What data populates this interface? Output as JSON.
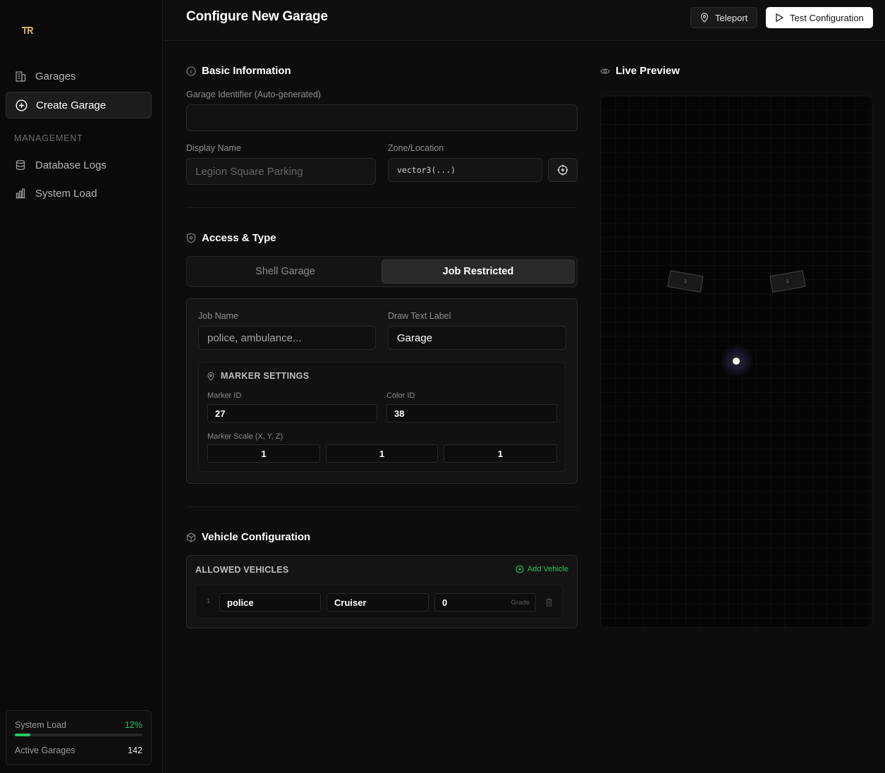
{
  "sidebar": {
    "logo_text": "TR",
    "nav": [
      {
        "label": "Garages",
        "icon": "building-icon"
      },
      {
        "label": "Create Garage",
        "icon": "plus-circle-icon",
        "active": true
      }
    ],
    "section_label": "MANAGEMENT",
    "management": [
      {
        "label": "Database Logs",
        "icon": "database-icon"
      },
      {
        "label": "System Load",
        "icon": "bar-chart-icon"
      }
    ],
    "status": {
      "load_label": "System Load",
      "load_value": "12%",
      "load_fraction": 0.12,
      "garages_label": "Active Garages",
      "garages_value": "142"
    }
  },
  "header": {
    "title": "Configure New Garage",
    "teleport_label": "Teleport",
    "test_label": "Test Configuration"
  },
  "basic": {
    "title": "Basic Information",
    "identifier_label": "Garage Identifier (Auto-generated)",
    "identifier_value": "",
    "display_name_label": "Display Name",
    "display_name_placeholder": "Legion Square Parking",
    "zone_label": "Zone/Location",
    "zone_value": "vector3(...)"
  },
  "access": {
    "title": "Access & Type",
    "options": [
      "Shell Garage",
      "Job Restricted"
    ],
    "selected": "Job Restricted",
    "job_name_label": "Job Name",
    "job_name_placeholder": "police, ambulance...",
    "draw_text_label": "Draw Text Label",
    "draw_text_value": "Garage",
    "marker": {
      "title": "MARKER SETTINGS",
      "marker_id_label": "Marker ID",
      "marker_id_value": "27",
      "color_id_label": "Color ID",
      "color_id_value": "38",
      "scale_label": "Marker Scale (X, Y, Z)",
      "scale_x": "1",
      "scale_y": "1",
      "scale_z": "1"
    }
  },
  "vehicles": {
    "title": "Vehicle Configuration",
    "list_title": "ALLOWED VEHICLES",
    "add_label": "Add Vehicle",
    "rows": [
      {
        "index": "1",
        "model": "police",
        "label": "Cruiser",
        "grade": "0",
        "grade_placeholder": "Grade"
      }
    ]
  },
  "preview": {
    "title": "Live Preview",
    "spots": [
      "1",
      "2"
    ]
  },
  "colors": {
    "accent_green": "#22c55e",
    "logo_gold": "#d4a95a",
    "background": "#0d0d0d"
  }
}
